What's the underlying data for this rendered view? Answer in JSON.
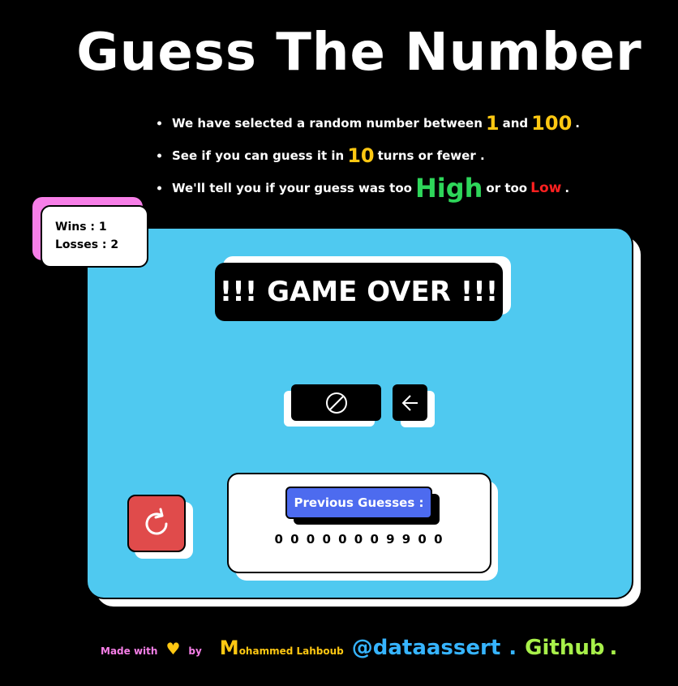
{
  "title": "Guess The Number",
  "rules": {
    "line1_pre": "We have selected a random number between",
    "line1_min": "1",
    "line1_and": "and",
    "line1_max": "100",
    "line1_end": ".",
    "line2_pre": "See if you can guess it in",
    "line2_turns": "10",
    "line2_post": "turns or fewer .",
    "line3_pre": "We'll tell you if your guess was too",
    "line3_high": "High",
    "line3_or": "or too",
    "line3_low": "Low",
    "line3_end": "."
  },
  "score": {
    "wins": "Wins : 1",
    "losses": "Losses : 2"
  },
  "status": "!!! GAME OVER !!!",
  "icons": {
    "disabled": "prohibited-icon",
    "submit": "arrow-left-icon",
    "reset": "restart-icon"
  },
  "previous": {
    "label": "Previous Guesses :",
    "values": "0 0 0 0 0 0 0 9 9 0 0"
  },
  "footer": {
    "made_with": "Made with",
    "heart": "♥",
    "by": "by",
    "name_initial": "M",
    "name_rest": "ohammed Lahboub",
    "handle": "@dataassert",
    "dot1": ".",
    "github": "Github",
    "dot2": "."
  },
  "colors": {
    "background": "#000000",
    "board": "#4fc9f0",
    "accent_yellow": "#ffc812",
    "high_green": "#2ed65a",
    "low_red": "#ff2020",
    "pink": "#f77fe8",
    "reset_red": "#e04b4b",
    "label_blue": "#4d6bef"
  }
}
